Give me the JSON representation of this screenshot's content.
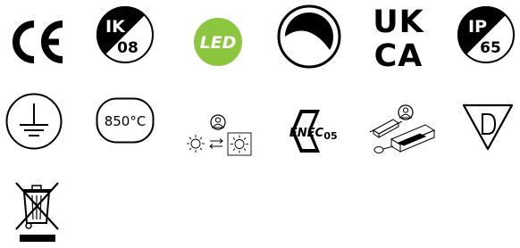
{
  "symbols": {
    "ik": {
      "top": "IK",
      "bottom": "08"
    },
    "led": {
      "text": "LED",
      "color": "#8cc63f"
    },
    "ukca": {
      "line1": "UK",
      "line2": "CA"
    },
    "ip": {
      "top": "IP",
      "bottom": "65"
    },
    "temperature": {
      "text": "850°C"
    },
    "enec": {
      "logo": "ENEC",
      "number": "05"
    }
  },
  "icons": [
    "ce-mark-icon",
    "ik08-impact-icon",
    "led-icon",
    "dimmable-icon",
    "ukca-mark-icon",
    "ip65-rating-icon",
    "earth-ground-icon",
    "glow-wire-850c-icon",
    "replaceable-light-source-icon",
    "enec05-mark-icon",
    "replaceable-control-gear-icon",
    "d-mark-icon",
    "weee-crossed-bin-icon"
  ],
  "colors": {
    "ink": "#000000",
    "led_green": "#8cc63f"
  }
}
